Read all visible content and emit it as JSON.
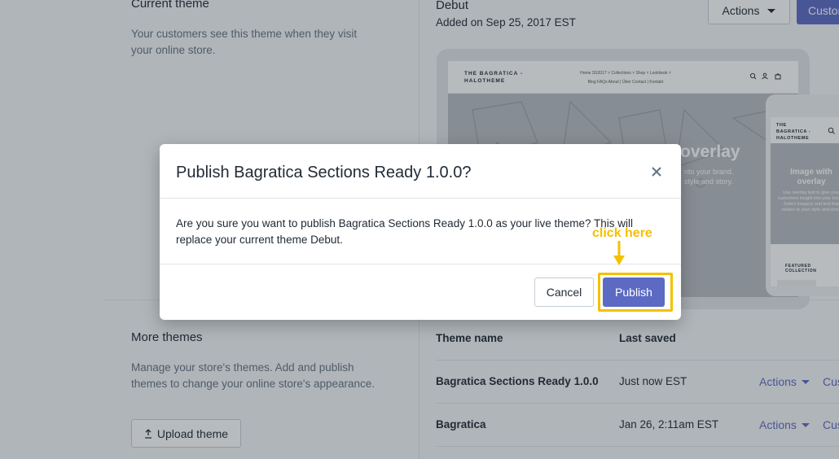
{
  "current_theme": {
    "section_title": "Current theme",
    "section_desc": "Your customers see this theme when they visit your online store.",
    "theme_name": "Debut",
    "theme_added": "Added on Sep 25, 2017 EST",
    "actions_label": "Actions",
    "customize_label": "Customize"
  },
  "preview": {
    "brand": [
      "THE BAGRATICA -",
      "HALOTHEME"
    ],
    "nav_row1": "Home   SS2017 ˅   Collections ˅   Shop ˅   Lookbook ˅",
    "nav_row2": "Blog   FAQs   About | Über   Contact | Kontakt",
    "hero_title": "overlay",
    "hero_sub": [
      "nto your brand.",
      "style and story."
    ],
    "mobile_brand": [
      "THE",
      "BAGRATICA -",
      "HALOTHEME"
    ],
    "mobile_hero_title": [
      "Image with",
      "overlay"
    ],
    "mobile_hero_sub": "Use overlay text to give your customers insight into your brand. Select imagery and text that relates to your style and story.",
    "mobile_featured": "FEATURED COLLECTION"
  },
  "more_themes": {
    "section_title": "More themes",
    "section_desc": "Manage your store's themes. Add and publish themes to change your online store's appearance.",
    "upload_label": "Upload theme",
    "columns": [
      "Theme name",
      "Last saved"
    ],
    "rows": [
      {
        "name": "Bagratica Sections Ready 1.0.0",
        "saved": "Just now EST",
        "actions": "Actions",
        "customize": "Customize"
      },
      {
        "name": "Bagratica",
        "saved": "Jan 26, 2:11am EST",
        "actions": "Actions",
        "customize": "Customize"
      }
    ]
  },
  "modal": {
    "title": "Publish Bagratica Sections Ready 1.0.0?",
    "body": "Are you sure you want to publish Bagratica Sections Ready 1.0.0 as your live theme? This will replace your current theme Debut.",
    "cancel_label": "Cancel",
    "publish_label": "Publish",
    "close_icon": "close-icon"
  },
  "annotation": {
    "note": "click here",
    "color": "#f5c000"
  },
  "colors": {
    "accent": "#5c6ac4",
    "background": "#f4f6f8"
  }
}
